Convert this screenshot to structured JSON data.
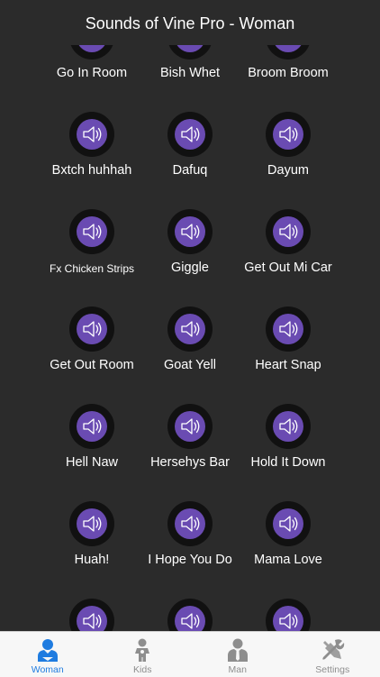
{
  "header": {
    "title": "Sounds of Vine Pro - Woman"
  },
  "colors": {
    "accent": "#1f7ce0",
    "button_fill": "#6a4bb2",
    "background": "#2b2b2b"
  },
  "sounds": [
    {
      "label": "Go In Room"
    },
    {
      "label": "Bish Whet"
    },
    {
      "label": "Broom Broom"
    },
    {
      "label": "Bxtch huhhah"
    },
    {
      "label": "Dafuq"
    },
    {
      "label": "Dayum"
    },
    {
      "label": "Fx Chicken Strips"
    },
    {
      "label": "Giggle"
    },
    {
      "label": "Get Out Mi Car"
    },
    {
      "label": "Get Out Room"
    },
    {
      "label": "Goat Yell"
    },
    {
      "label": "Heart Snap"
    },
    {
      "label": "Hell Naw"
    },
    {
      "label": "Hersehys Bar"
    },
    {
      "label": "Hold It Down"
    },
    {
      "label": "Huah!"
    },
    {
      "label": "I Hope You Do"
    },
    {
      "label": "Mama Love"
    },
    {
      "label": ""
    },
    {
      "label": ""
    },
    {
      "label": ""
    }
  ],
  "tabs": [
    {
      "label": "Woman",
      "icon": "woman-user-icon",
      "active": true
    },
    {
      "label": "Kids",
      "icon": "kid-icon",
      "active": false
    },
    {
      "label": "Man",
      "icon": "man-suit-icon",
      "active": false
    },
    {
      "label": "Settings",
      "icon": "tools-icon",
      "active": false
    }
  ]
}
